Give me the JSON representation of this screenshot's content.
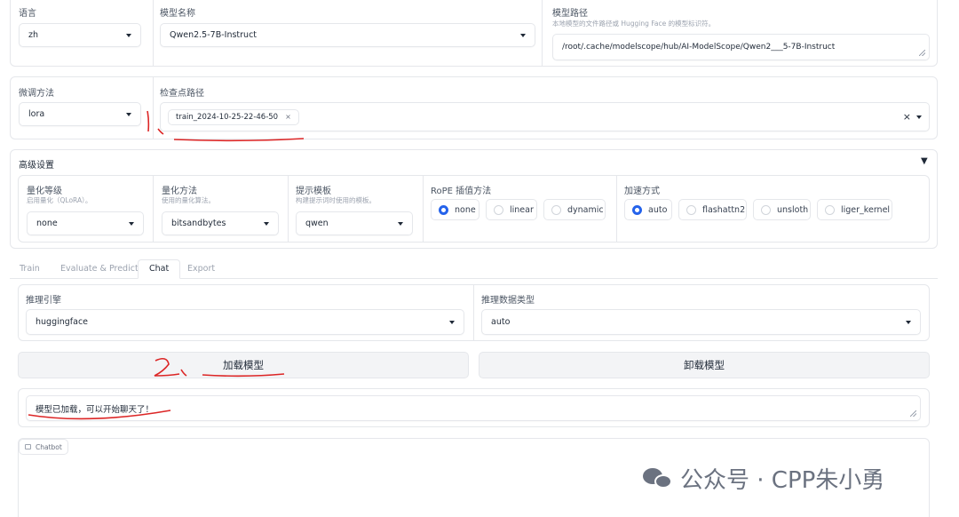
{
  "top": {
    "language_label": "语言",
    "language_value": "zh",
    "model_name_label": "模型名称",
    "model_name_value": "Qwen2.5-7B-Instruct",
    "model_path_label": "模型路径",
    "model_path_hint": "本地模型的文件路径或 Hugging Face 的模型标识符。",
    "model_path_value": "/root/.cache/modelscope/hub/AI-ModelScope/Qwen2___5-7B-Instruct"
  },
  "finetune": {
    "method_label": "微调方法",
    "method_value": "lora",
    "checkpoint_label": "检查点路径",
    "checkpoint_tag": "train_2024-10-25-22-46-50",
    "tag_close": "×",
    "clear_icon": "×"
  },
  "advanced": {
    "title": "高级设置",
    "toggle": "▼",
    "quant_level_label": "量化等级",
    "quant_level_hint": "启用量化（QLoRA）。",
    "quant_level_value": "none",
    "quant_method_label": "量化方法",
    "quant_method_hint": "使用的量化算法。",
    "quant_method_value": "bitsandbytes",
    "template_label": "提示模板",
    "template_hint": "构建提示词时使用的模板。",
    "template_value": "qwen",
    "rope_label": "RoPE 插值方法",
    "rope_options": [
      "none",
      "linear",
      "dynamic"
    ],
    "accel_label": "加速方式",
    "accel_options": [
      "auto",
      "flashattn2",
      "unsloth",
      "liger_kernel"
    ]
  },
  "tabs": [
    "Train",
    "Evaluate & Predict",
    "Chat",
    "Export"
  ],
  "chat": {
    "engine_label": "推理引擎",
    "engine_value": "huggingface",
    "dtype_label": "推理数据类型",
    "dtype_value": "auto",
    "load_button": "加载模型",
    "unload_button": "卸载模型",
    "status_text": "模型已加载，可以开始聊天了！",
    "chatbot_label": "Chatbot"
  },
  "annotations": {
    "mark1": "1、",
    "mark2": "2、"
  },
  "watermark": "公众号 · CPP朱小勇",
  "colors": {
    "accent": "#2563eb",
    "annotation": "#dc2626"
  }
}
